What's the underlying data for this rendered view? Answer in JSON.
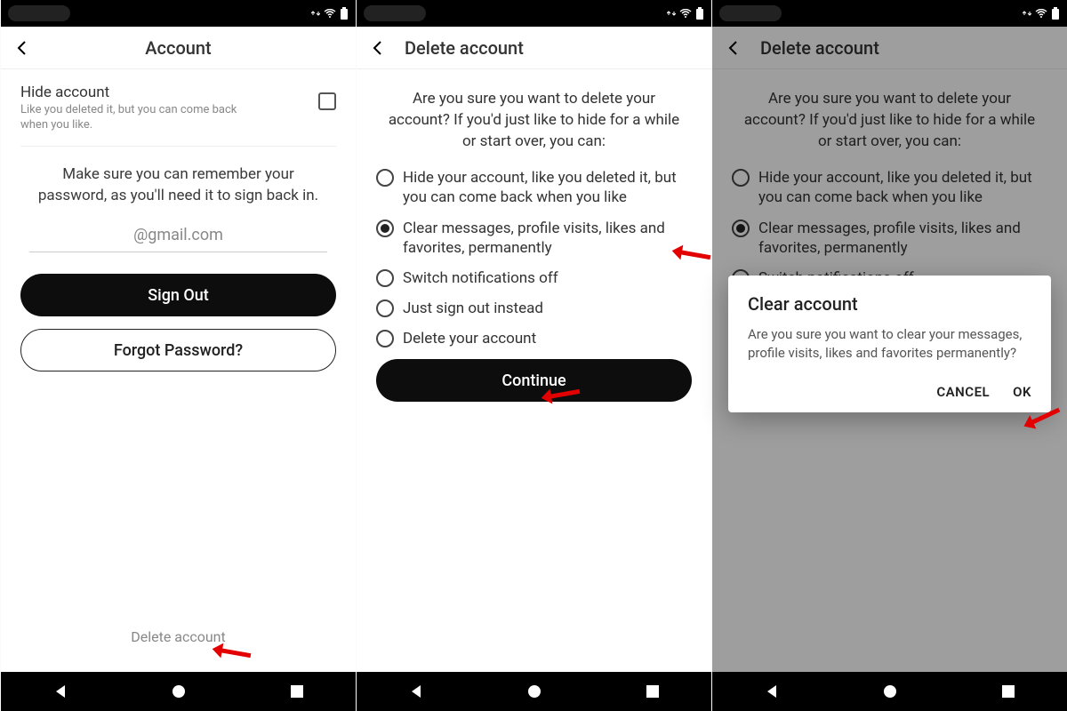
{
  "screen1": {
    "title": "Account",
    "hide_title": "Hide account",
    "hide_sub": "Like you deleted it, but you can come back when you like.",
    "remember_msg": "Make sure you can remember your password, as you'll need it to sign back in.",
    "email": "@gmail.com",
    "signout": "Sign Out",
    "forgot": "Forgot Password?",
    "delete_link": "Delete account"
  },
  "screen2": {
    "title": "Delete account",
    "prompt": "Are you sure you want to delete your account? If you'd just like to hide for a while or start over, you can:",
    "options": [
      "Hide your account, like you deleted it, but you can come back when you like",
      "Clear messages, profile visits, likes and favorites, permanently",
      "Switch notifications off",
      "Just sign out instead",
      "Delete your account"
    ],
    "continue": "Continue"
  },
  "screen3": {
    "title": "Delete account",
    "prompt": "Are you sure you want to delete your account? If you'd just like to hide for a while or start over, you can:",
    "options": [
      "Hide your account, like you deleted it, but you can come back when you like",
      "Clear messages, profile visits, likes and favorites, permanently",
      "Switch notifications off"
    ],
    "dialog": {
      "title": "Clear account",
      "body": "Are you sure you want to clear your messages, profile visits, likes and favorites permanently?",
      "cancel": "CANCEL",
      "ok": "OK"
    }
  }
}
